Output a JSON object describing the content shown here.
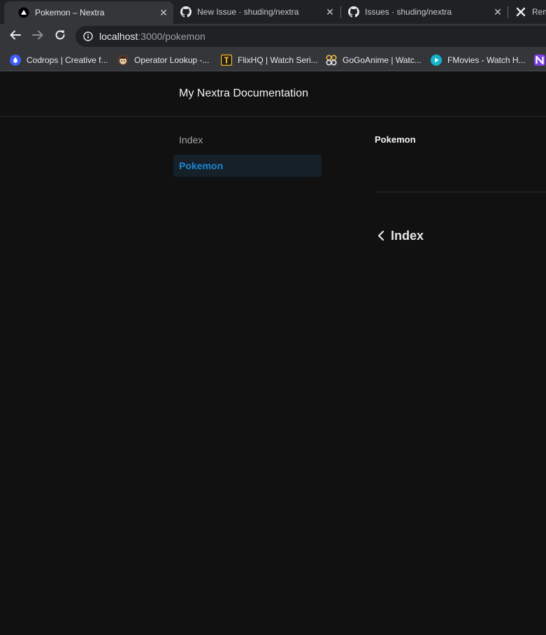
{
  "browser": {
    "tabs": [
      {
        "title": "Pokemon – Nextra",
        "icon": "nextra-triangle-icon"
      },
      {
        "title": "New Issue · shuding/nextra",
        "icon": "github-icon"
      },
      {
        "title": "Issues · shuding/nextra",
        "icon": "github-icon"
      },
      {
        "title": "Rem",
        "icon": "remix-icon"
      }
    ],
    "url": {
      "host": "localhost",
      "rest": ":3000/pokemon"
    },
    "bookmarks": [
      {
        "label": "Codrops | Creative f...",
        "icon": "codrops-drop-icon",
        "color": "#3f5efb"
      },
      {
        "label": "Operator Lookup -...",
        "icon": "operator-avatar-icon",
        "color": "#c9a27e"
      },
      {
        "label": "FlixHQ | Watch Seri...",
        "icon": "flixhq-icon",
        "color": "#f5b81c"
      },
      {
        "label": "GoGoAnime | Watc...",
        "icon": "gogoanime-icon",
        "color": "#e8b84d"
      },
      {
        "label": "FMovies - Watch H...",
        "icon": "fmovies-play-icon",
        "color": "#12b5cb"
      },
      {
        "label": "",
        "icon": "purple-n-icon",
        "color": "#7b3fe4"
      }
    ]
  },
  "site": {
    "title": "My Nextra Documentation"
  },
  "sidebar": {
    "items": [
      {
        "label": "Index",
        "active": false
      },
      {
        "label": "Pokemon",
        "active": true
      }
    ]
  },
  "content": {
    "title": "Pokemon",
    "prev_label": "Index"
  },
  "colors": {
    "accent": "#1b87d3",
    "background": "#111111"
  }
}
